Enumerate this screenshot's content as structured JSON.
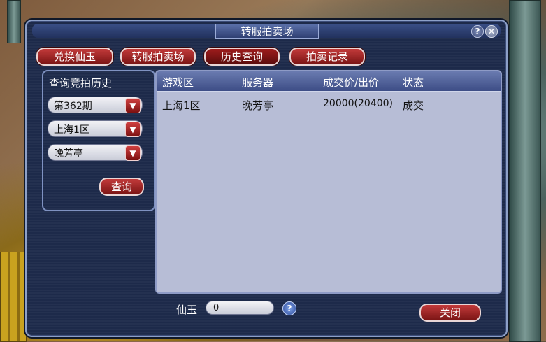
{
  "window": {
    "title": "转服拍卖场"
  },
  "tabs": [
    {
      "label": "兑换仙玉"
    },
    {
      "label": "转服拍卖场"
    },
    {
      "label": "历史查询"
    },
    {
      "label": "拍卖记录"
    }
  ],
  "left_panel": {
    "title": "查询竞拍历史",
    "period": "第362期",
    "zone": "上海1区",
    "server": "晚芳亭",
    "query_button": "查询"
  },
  "table": {
    "columns": [
      "游戏区",
      "服务器",
      "成交价/出价",
      "状态"
    ],
    "rows": [
      [
        "上海1区",
        "晚芳亭",
        "20000(20400)",
        "成交"
      ]
    ]
  },
  "footer": {
    "currency_label": "仙玉",
    "currency_value": "0",
    "help_glyph": "?",
    "close_button": "关闭"
  },
  "icons": {
    "help_top": "?",
    "close_top": "✕",
    "dropdown": "▼"
  },
  "colors": {
    "panel_bg": "#1d2a4a",
    "button_red": "#9e1c1c",
    "table_bg": "#b7bdd6",
    "header_blue": "#3d4d86"
  }
}
